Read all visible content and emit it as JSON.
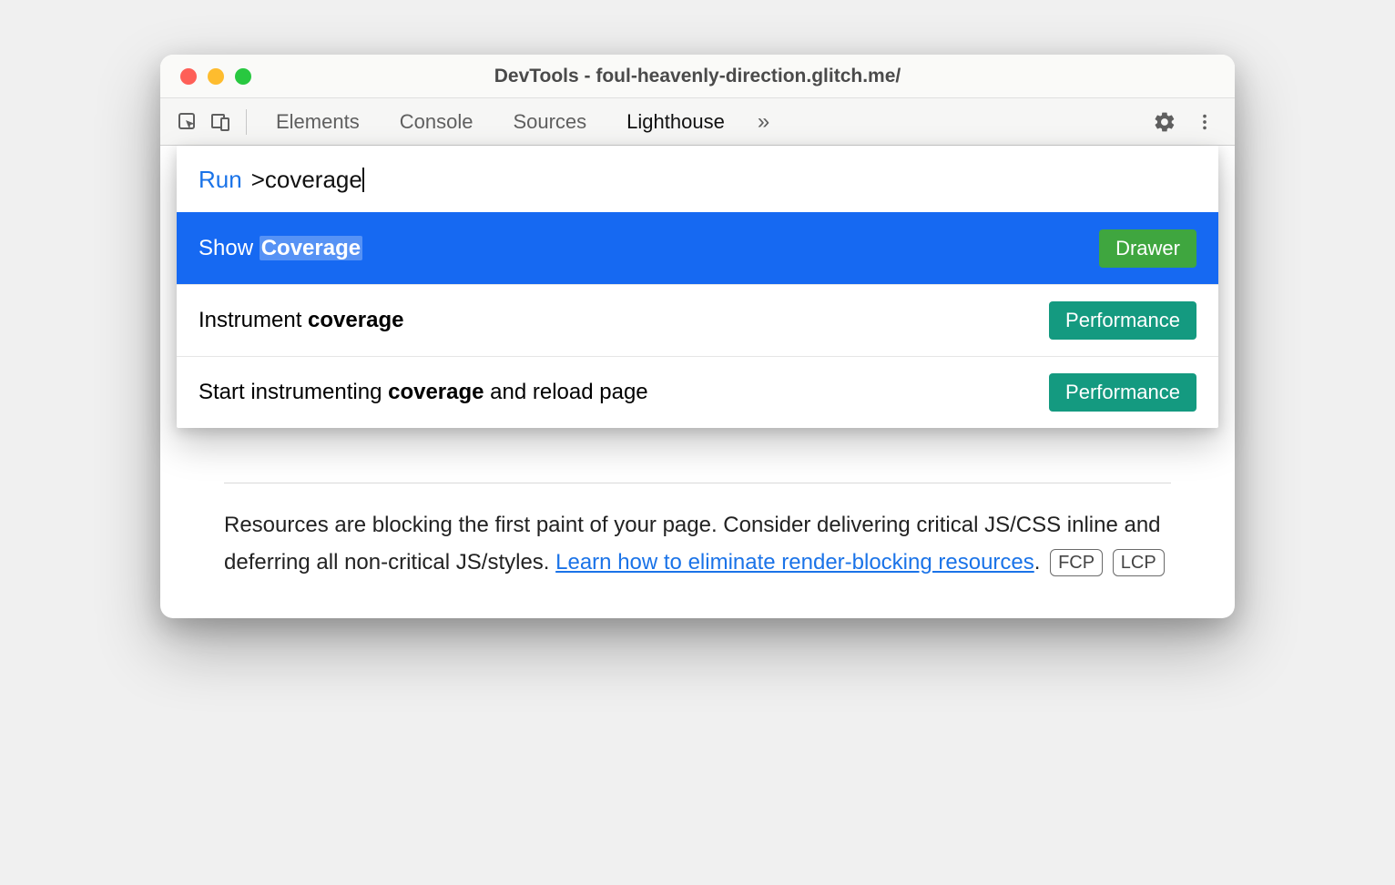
{
  "window": {
    "title": "DevTools - foul-heavenly-direction.glitch.me/"
  },
  "tabs": {
    "elements": "Elements",
    "console": "Console",
    "sources": "Sources",
    "lighthouse": "Lighthouse",
    "more": "»"
  },
  "command_menu": {
    "prefix": "Run",
    "query": ">coverage",
    "items": [
      {
        "pre": "Show ",
        "match": "Coverage",
        "post": "",
        "badge": "Drawer",
        "badge_kind": "drawer",
        "selected": true
      },
      {
        "pre": "Instrument ",
        "match": "coverage",
        "post": "",
        "badge": "Performance",
        "badge_kind": "perf",
        "selected": false
      },
      {
        "pre": "Start instrumenting ",
        "match": "coverage",
        "post": " and reload page",
        "badge": "Performance",
        "badge_kind": "perf",
        "selected": false
      }
    ]
  },
  "description": {
    "text_before_link": "Resources are blocking the first paint of your page. Consider delivering critical JS/CSS inline and deferring all non-critical JS/styles. ",
    "link_text": "Learn how to eliminate render-blocking resources",
    "text_after_link": ".",
    "pills": [
      "FCP",
      "LCP"
    ]
  }
}
